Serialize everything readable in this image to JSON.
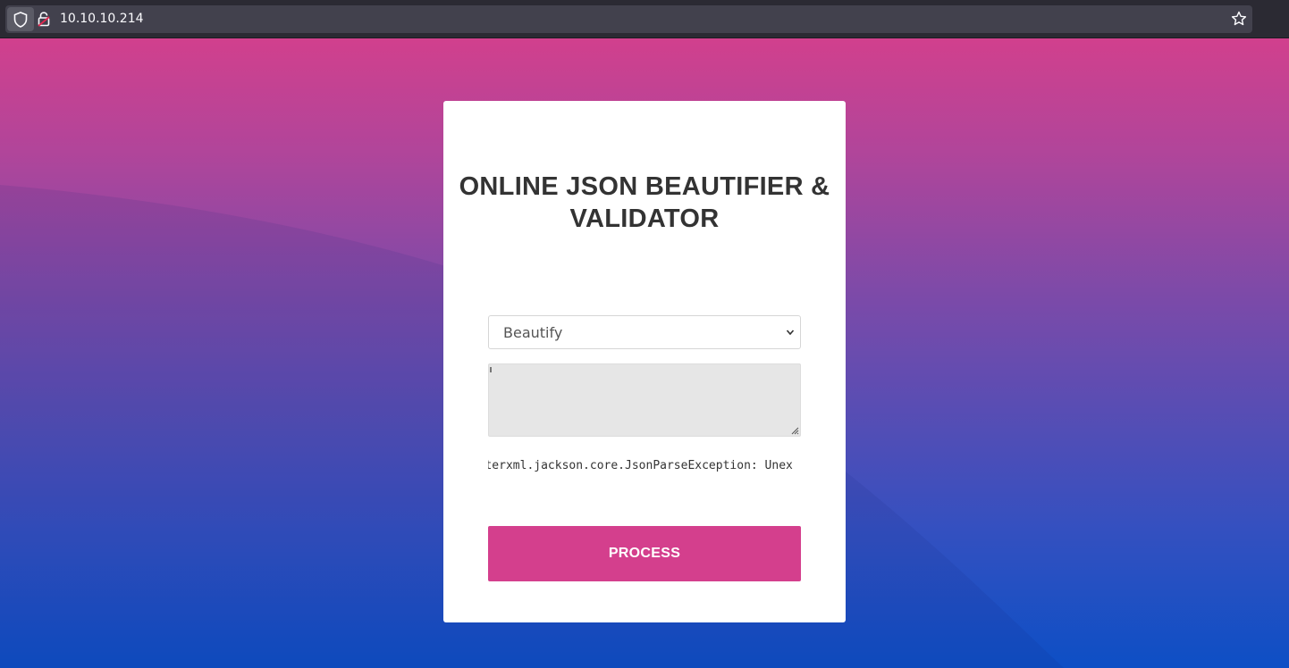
{
  "browser": {
    "url": "10.10.10.214",
    "icons": {
      "shield": "shield-icon",
      "lock": "lock-insecure-icon",
      "bookmark": "star-icon"
    }
  },
  "form": {
    "title": "ONLINE JSON BEAUTIFIER & VALIDATOR",
    "mode_select": {
      "selected": "Beautify"
    },
    "input": {
      "value": ""
    },
    "output_text": "fasterxml.jackson.core.JsonParseException: Unex",
    "process_label": "PROCESS"
  },
  "colors": {
    "accent": "#d43f8d",
    "gradient_top": "#d1408d",
    "gradient_bottom": "#0d4fc5",
    "title": "#333333"
  }
}
